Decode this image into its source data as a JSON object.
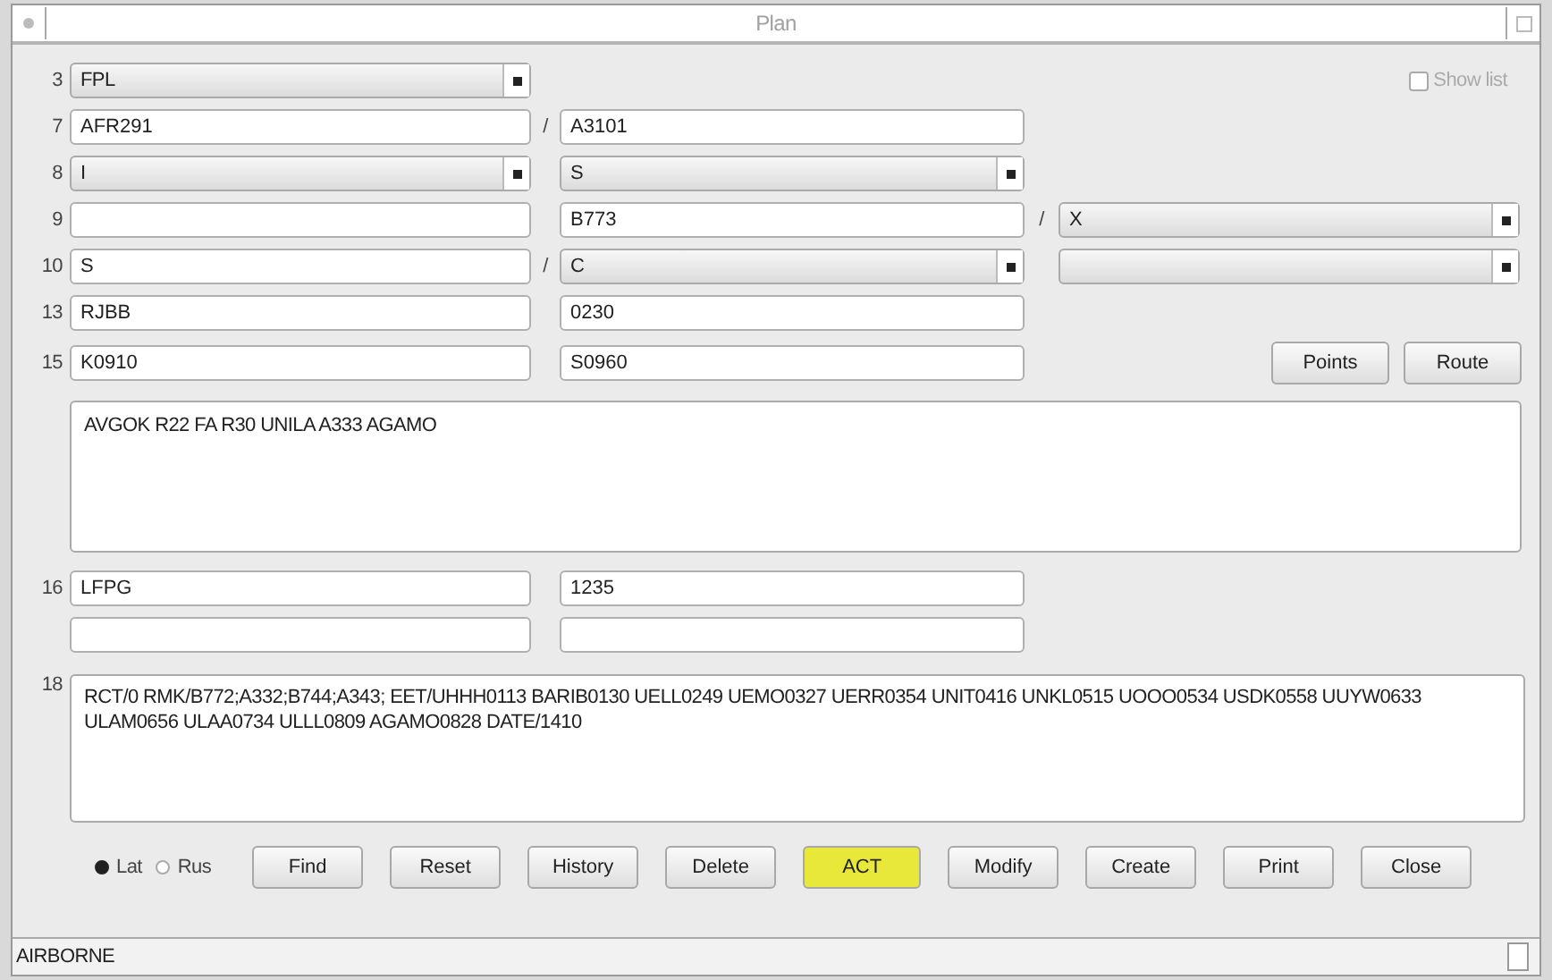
{
  "window": {
    "title": "Plan"
  },
  "rows": [
    {
      "label": "3",
      "items": [
        {
          "kind": "select",
          "value": "FPL"
        }
      ],
      "checkbox": {
        "label": "Show list",
        "checked": false
      }
    },
    {
      "label": "7",
      "items": [
        {
          "kind": "input",
          "value": "AFR291"
        },
        {
          "kind": "slash",
          "text": "/"
        },
        {
          "kind": "input",
          "value": "A3101"
        }
      ]
    },
    {
      "label": "8",
      "items": [
        {
          "kind": "select",
          "value": "I"
        },
        {
          "kind": "gap"
        },
        {
          "kind": "select",
          "value": "S"
        }
      ]
    },
    {
      "label": "9",
      "items": [
        {
          "kind": "input",
          "value": ""
        },
        {
          "kind": "gap"
        },
        {
          "kind": "input",
          "value": "B773"
        },
        {
          "kind": "slash",
          "text": "/"
        },
        {
          "kind": "select",
          "value": "X"
        }
      ]
    },
    {
      "label": "10",
      "items": [
        {
          "kind": "input",
          "value": "S"
        },
        {
          "kind": "slash",
          "text": "/"
        },
        {
          "kind": "select",
          "value": "C"
        },
        {
          "kind": "gap"
        },
        {
          "kind": "select",
          "value": ""
        }
      ]
    },
    {
      "label": "13",
      "items": [
        {
          "kind": "input",
          "value": "RJBB"
        },
        {
          "kind": "gap"
        },
        {
          "kind": "input",
          "value": "0230"
        }
      ]
    },
    {
      "label": "15",
      "items": [
        {
          "kind": "input",
          "value": "K0910"
        },
        {
          "kind": "gap"
        },
        {
          "kind": "input",
          "value": "S0960"
        }
      ],
      "buttons": [
        "Points",
        "Route"
      ]
    }
  ],
  "route": "AVGOK R22 FA R30 UNILA A333 AGAMO",
  "rows_after": [
    {
      "label": "16",
      "items": [
        {
          "kind": "input",
          "value": "LFPG"
        },
        {
          "kind": "gap"
        },
        {
          "kind": "input",
          "value": "1235"
        }
      ]
    },
    {
      "items": [
        {
          "kind": "input",
          "value": ""
        },
        {
          "kind": "gap"
        },
        {
          "kind": "input",
          "value": ""
        }
      ]
    }
  ],
  "field_18": {
    "label": "18",
    "value": "RCT/0 RMK/B772;A332;B744;A343; EET/UHHH0113 BARIB0130 UELL0249 UEMO0327 UERR0354 UNIT0416 UNKL0515 UOOO0534 USDK0558 UUYW0633 ULAM0656 ULAA0734 ULLL0809 AGAMO0828 DATE/1410"
  },
  "alphabet": [
    {
      "label": "Lat",
      "selected": true
    },
    {
      "label": "Rus",
      "selected": false
    }
  ],
  "buttons": [
    {
      "label": "Find",
      "highlighted": false
    },
    {
      "label": "Reset",
      "highlighted": false
    },
    {
      "label": "History",
      "highlighted": false
    },
    {
      "label": "Delete",
      "highlighted": false
    },
    {
      "label": "ACT",
      "highlighted": true
    },
    {
      "label": "Modify",
      "highlighted": false
    },
    {
      "label": "Create",
      "highlighted": false
    },
    {
      "label": "Print",
      "highlighted": false
    },
    {
      "label": "Close",
      "highlighted": false
    }
  ],
  "status_bar": "AIRBORNE"
}
